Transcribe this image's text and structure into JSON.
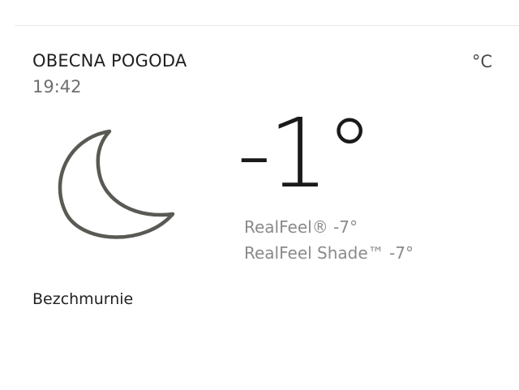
{
  "current_weather": {
    "title": "OBECNA POGODA",
    "time": "19:42",
    "unit": "°C",
    "temperature": "-1°",
    "realfeel": "RealFeel® -7°",
    "realfeel_shade": "RealFeel Shade™ -7°",
    "condition": "Bezchmurnie",
    "icon": "moon-icon",
    "colors": {
      "icon_stroke": "#5a5a55",
      "title": "#1f1f1f",
      "muted_text": "#8a8a8a"
    }
  }
}
